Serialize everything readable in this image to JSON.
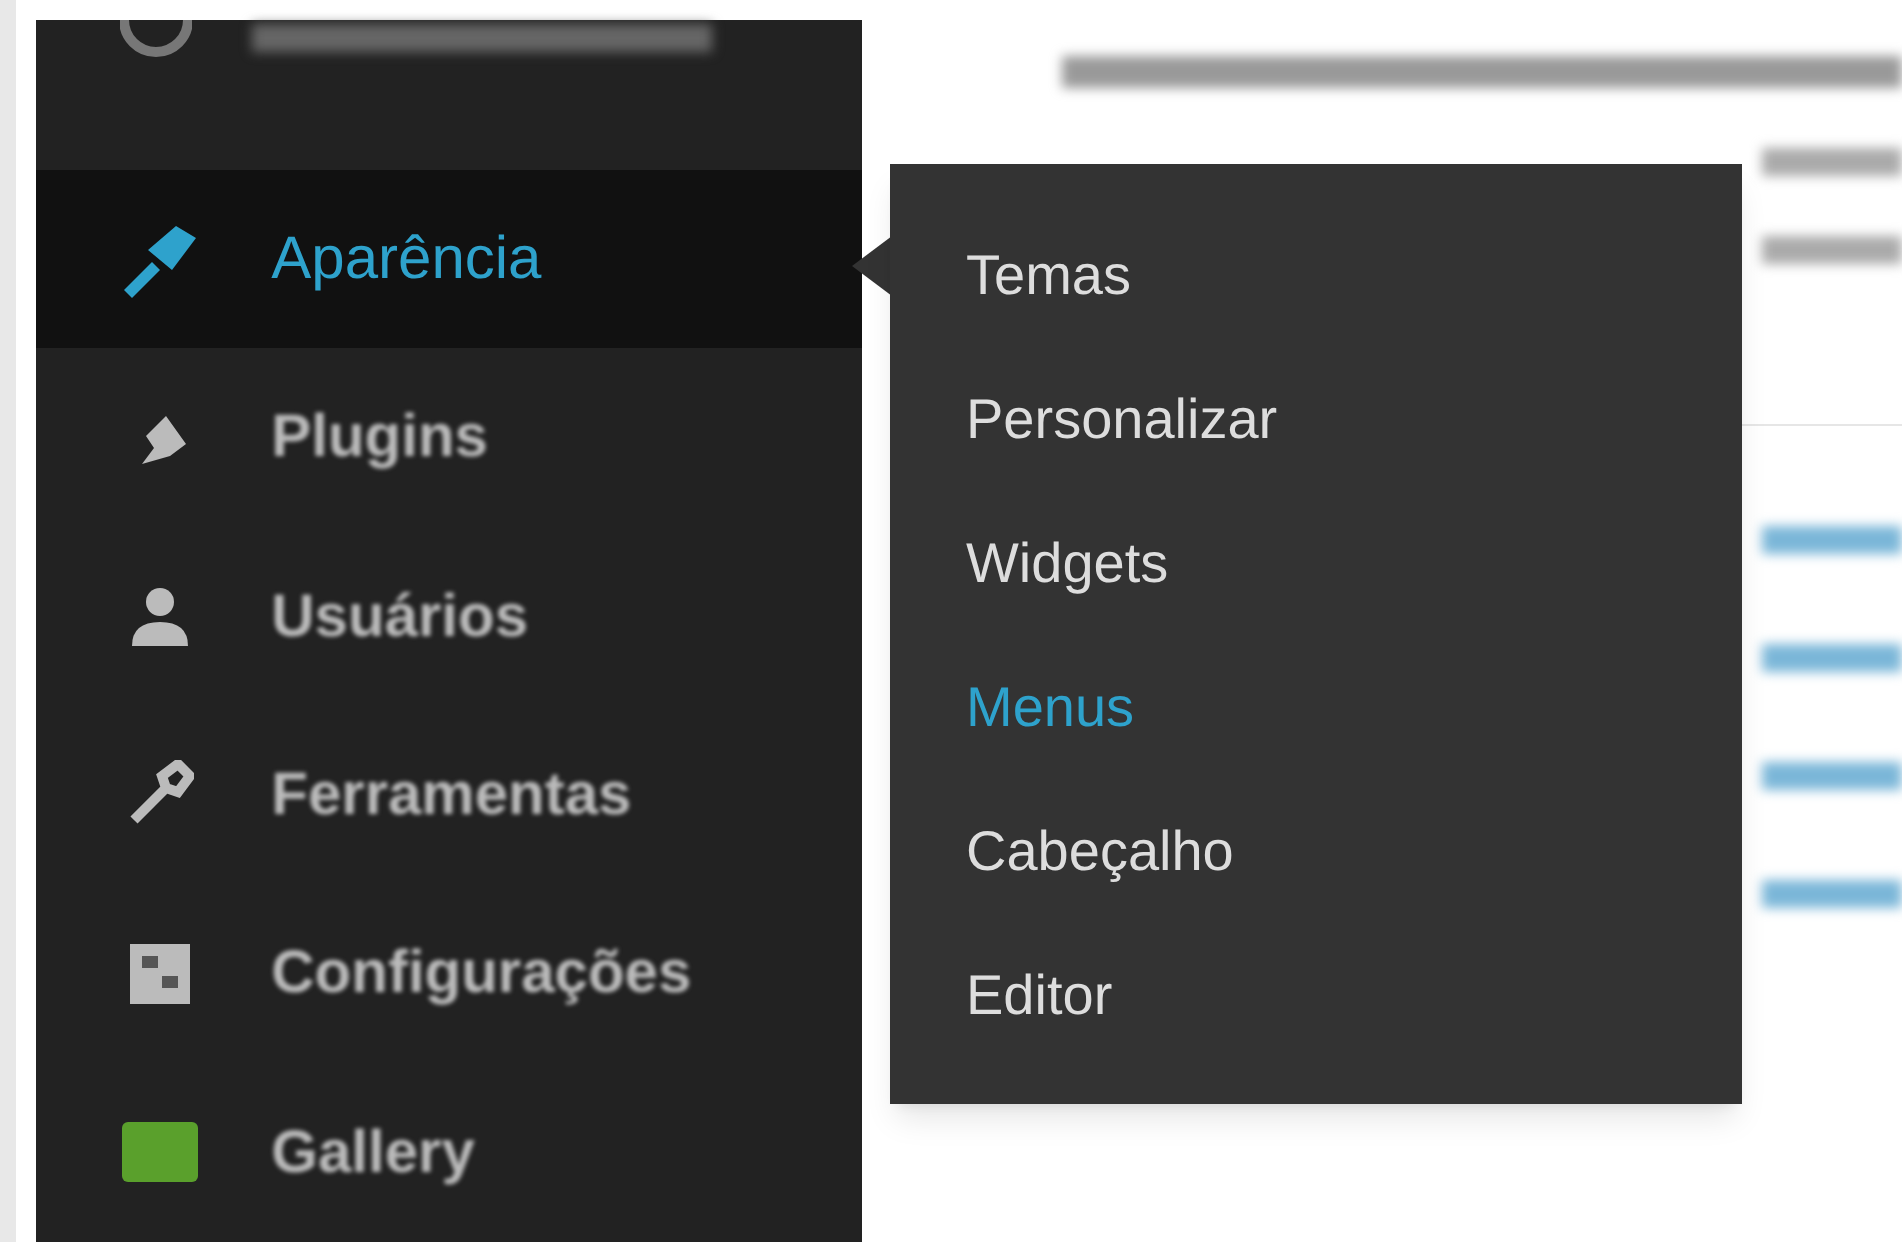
{
  "sidebar": {
    "items": [
      {
        "label": "Aparência",
        "selected": true
      },
      {
        "label": "Plugins",
        "selected": false
      },
      {
        "label": "Usuários",
        "selected": false
      },
      {
        "label": "Ferramentas",
        "selected": false
      },
      {
        "label": "Configurações",
        "selected": false
      },
      {
        "label": "Gallery",
        "selected": false
      }
    ]
  },
  "submenu": {
    "items": [
      {
        "label": "Temas",
        "selected": false
      },
      {
        "label": "Personalizar",
        "selected": false
      },
      {
        "label": "Widgets",
        "selected": false
      },
      {
        "label": "Menus",
        "selected": true
      },
      {
        "label": "Cabeçalho",
        "selected": false
      },
      {
        "label": "Editor",
        "selected": false
      }
    ]
  }
}
